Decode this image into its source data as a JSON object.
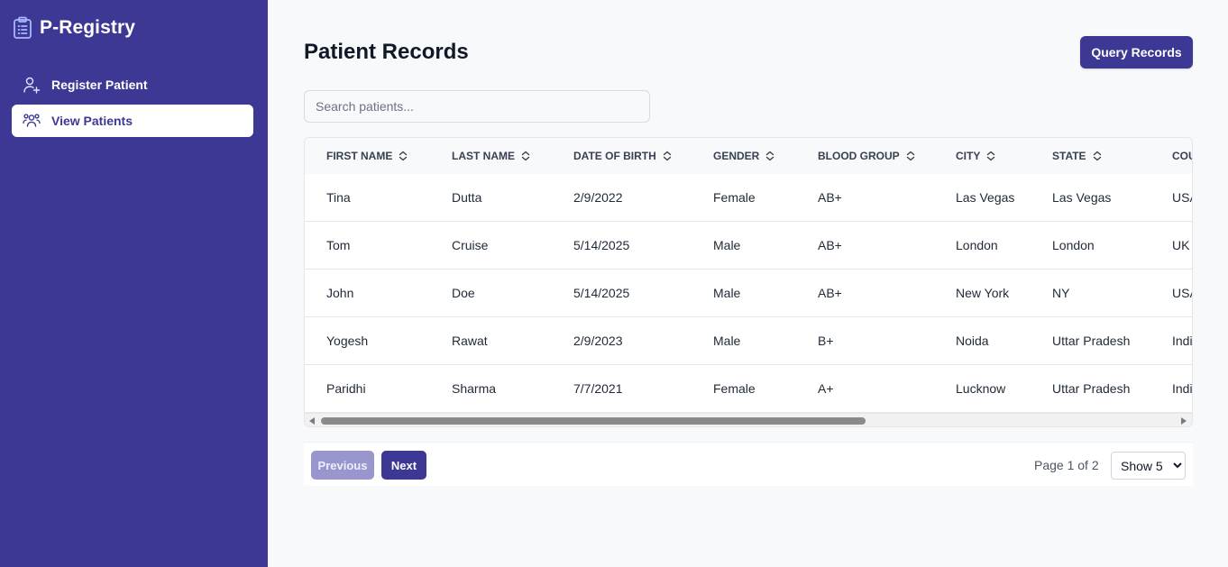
{
  "app": {
    "title": "P-Registry",
    "accent_color": "#3c3894"
  },
  "sidebar": {
    "items": [
      {
        "label": "Register Patient",
        "icon": "user-plus-icon",
        "active": false
      },
      {
        "label": "View Patients",
        "icon": "users-icon",
        "active": true
      }
    ]
  },
  "main": {
    "title": "Patient Records",
    "query_button": "Query Records",
    "search": {
      "placeholder": "Search patients...",
      "value": ""
    }
  },
  "table": {
    "columns": [
      "First Name",
      "Last Name",
      "Date of Birth",
      "Gender",
      "Blood Group",
      "City",
      "State",
      "Cou"
    ],
    "rows": [
      [
        "Tina",
        "Dutta",
        "2/9/2022",
        "Female",
        "AB+",
        "Las Vegas",
        "Las Vegas",
        "USA"
      ],
      [
        "Tom",
        "Cruise",
        "5/14/2025",
        "Male",
        "AB+",
        "London",
        "London",
        "UK"
      ],
      [
        "John",
        "Doe",
        "5/14/2025",
        "Male",
        "AB+",
        "New York",
        "NY",
        "USA"
      ],
      [
        "Yogesh",
        "Rawat",
        "2/9/2023",
        "Male",
        "B+",
        "Noida",
        "Uttar Pradesh",
        "India"
      ],
      [
        "Paridhi",
        "Sharma",
        "7/7/2021",
        "Female",
        "A+",
        "Lucknow",
        "Uttar Pradesh",
        "India"
      ]
    ]
  },
  "pagination": {
    "previous_label": "Previous",
    "next_label": "Next",
    "page_info": "Page 1 of 2",
    "show_selected": "Show 5",
    "show_options": [
      "Show 5"
    ]
  }
}
